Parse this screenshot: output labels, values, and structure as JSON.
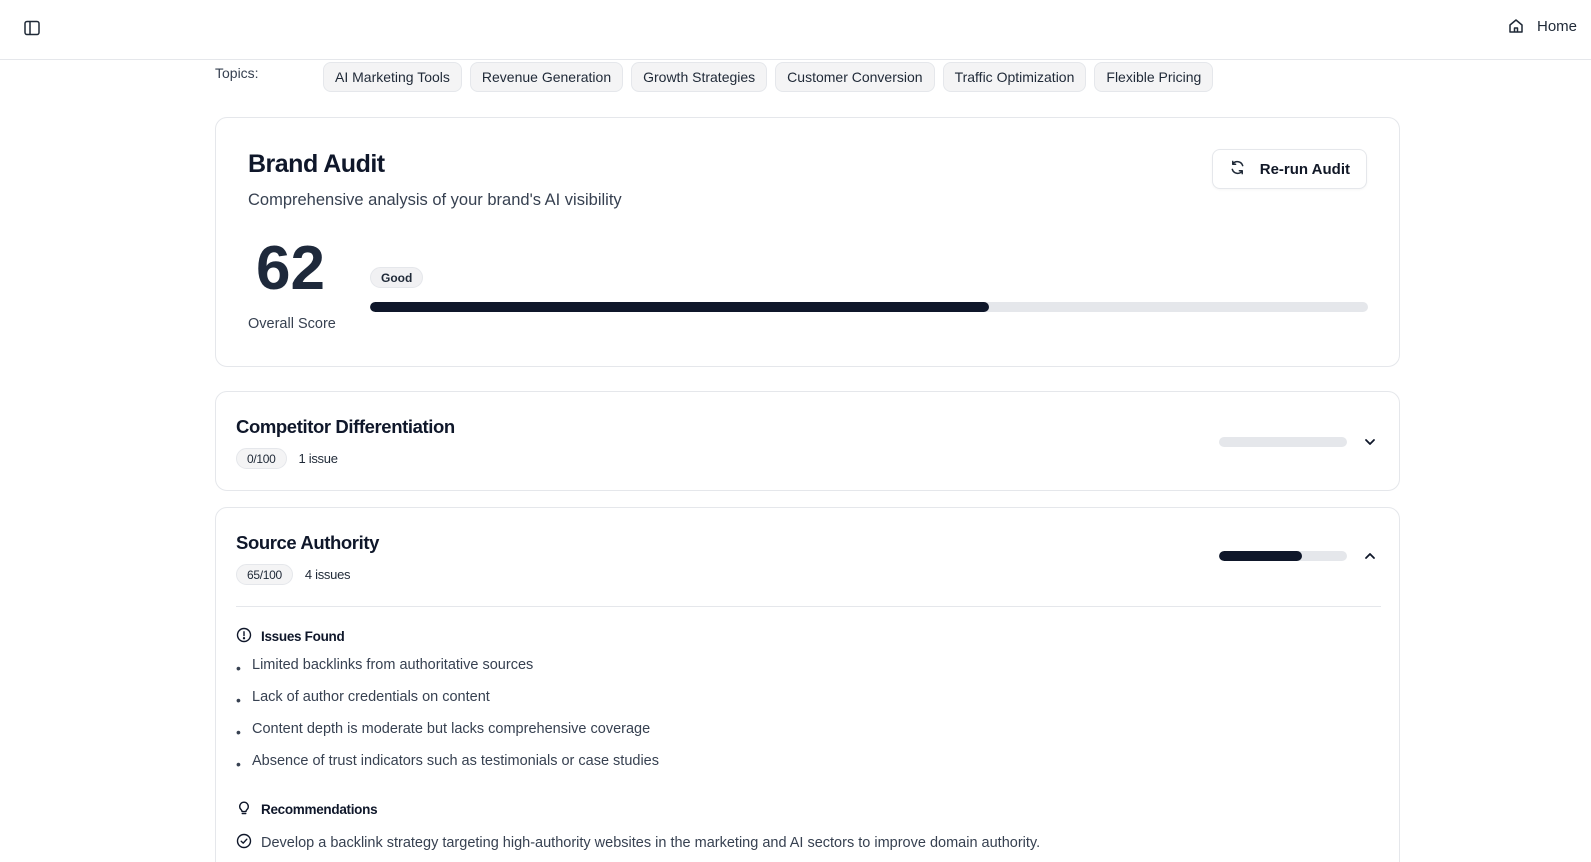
{
  "topbar": {
    "sidebar_toggle_icon": "sidebar-panel-icon",
    "home_icon": "home-icon",
    "home_label": "Home"
  },
  "topics": {
    "label": "Topics:",
    "items": [
      "AI Marketing Tools",
      "Revenue Generation",
      "Growth Strategies",
      "Customer Conversion",
      "Traffic Optimization",
      "Flexible Pricing"
    ]
  },
  "audit": {
    "title": "Brand Audit",
    "subtitle": "Comprehensive analysis of your brand's AI visibility",
    "rerun_label": "Re-run Audit",
    "rerun_icon": "refresh-icon",
    "score": "62",
    "score_label": "Overall Score",
    "rating": "Good",
    "score_fraction": 0.62
  },
  "sections": [
    {
      "title": "Competitor Differentiation",
      "score_text": "0/100",
      "issues_text": "1 issue",
      "score_fraction": 0.0,
      "expanded": false,
      "chevron_icon": "chevron-down-icon"
    },
    {
      "title": "Source Authority",
      "score_text": "65/100",
      "issues_text": "4 issues",
      "score_fraction": 0.65,
      "expanded": true,
      "chevron_icon": "chevron-up-icon",
      "issues_heading": "Issues Found",
      "issues": [
        "Limited backlinks from authoritative sources",
        "Lack of author credentials on content",
        "Content depth is moderate but lacks comprehensive coverage",
        "Absence of trust indicators such as testimonials or case studies"
      ],
      "recommendations_heading": "Recommendations",
      "recommendations": [
        "Develop a backlink strategy targeting high-authority websites in the marketing and AI sectors to improve domain authority."
      ]
    }
  ],
  "colors": {
    "accent": "#0f172a",
    "track": "#e5e7eb",
    "border": "#e5e7eb",
    "chip_bg": "#f4f4f5"
  }
}
